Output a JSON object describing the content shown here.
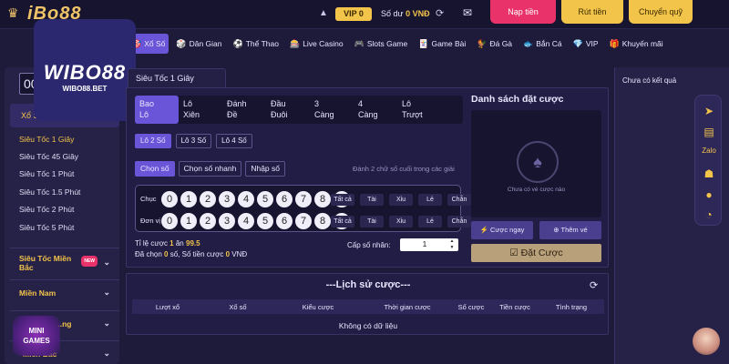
{
  "topbar": {
    "brand": "iBo88",
    "vip": "VIP 0",
    "balance_label": "Số dư",
    "balance_value": "0 VNĐ",
    "deposit": "Nạp tiền",
    "withdraw": "Rút tiền",
    "transfer": "Chuyển quỹ"
  },
  "logo": {
    "text": "WIBO88",
    "sub": "WIBO88.BET"
  },
  "nav": [
    {
      "label": "Xổ Số",
      "icon": "🎯"
    },
    {
      "label": "Dân Gian",
      "icon": "🎲"
    },
    {
      "label": "Thể Thao",
      "icon": "⚽"
    },
    {
      "label": "Live Casino",
      "icon": "🎰"
    },
    {
      "label": "Slots Game",
      "icon": "🎮"
    },
    {
      "label": "Game Bài",
      "icon": "🃏"
    },
    {
      "label": "Đá Gà",
      "icon": "🐓"
    },
    {
      "label": "Bắn Cá",
      "icon": "🐟"
    },
    {
      "label": "VIP",
      "icon": "💎"
    },
    {
      "label": "Khuyến mãi",
      "icon": "🎁"
    }
  ],
  "sidebar": {
    "timer": "00",
    "head": "Xổ Số",
    "items": [
      "Siêu Tốc 1 Giây",
      "Siêu Tốc 45 Giây",
      "Siêu Tốc 1 Phút",
      "Siêu Tốc 1.5 Phút",
      "Siêu Tốc 2 Phút",
      "Siêu Tốc 5 Phút"
    ],
    "group1_line1": "Siêu Tốc Miền",
    "group1_line2": "Bắc",
    "group1_badge": "NEW",
    "group2": "Miền Nam",
    "group3": "...ng",
    "group4": "Miền Bắc",
    "mini_line1": "MINI",
    "mini_line2": "GAMES"
  },
  "main": {
    "tab": "Siêu Tốc 1 Giây",
    "kinds": [
      {
        "l1": "Bao",
        "l2": "Lô"
      },
      {
        "l1": "Lô",
        "l2": "Xiên"
      },
      {
        "l1": "Đánh",
        "l2": "Đề"
      },
      {
        "l1": "Đầu",
        "l2": "Đuôi"
      },
      {
        "l1": "3",
        "l2": "Càng"
      },
      {
        "l1": "4",
        "l2": "Càng"
      },
      {
        "l1": "Lô",
        "l2": "Trượt"
      }
    ],
    "subtabs": [
      "Lô 2 Số",
      "Lô 3 Số",
      "Lô 4 Số"
    ],
    "modes": [
      "Chọn số",
      "Chọn số nhanh",
      "Nhập số"
    ],
    "hint": "Đánh 2 chữ số cuối trong các giải",
    "row1_label": "Chục",
    "row2_label": "Đơn vị",
    "digits": [
      "0",
      "1",
      "2",
      "3",
      "4",
      "5",
      "6",
      "7",
      "8",
      "9"
    ],
    "quick": [
      "Tất cả",
      "Tài",
      "Xỉu",
      "Lẻ",
      "Chẵn"
    ],
    "odds_prefix": "Tỉ lệ cược",
    "odds_a": "1",
    "odds_mid": "ăn",
    "odds_b": "99.5",
    "chosen_prefix": "Đã chọn",
    "chosen_count": "0",
    "chosen_mid": "số, Số tiền cược",
    "chosen_amount": "0",
    "chosen_unit": "VNĐ",
    "mult_label": "Cấp số nhân:",
    "mult_value": "1"
  },
  "betlist": {
    "title": "Danh sách đặt cược",
    "empty": "Chưa có vé cược nào",
    "fast": "⚡ Cược ngay",
    "add": "⊕ Thêm vé",
    "bet": "☑ Đặt Cược"
  },
  "history": {
    "title": "---Lịch sử cược---",
    "columns": [
      "Lượt xổ",
      "Xổ số",
      "Kiểu cược",
      "Thời gian cược",
      "Số cược",
      "Tiền cược",
      "Tình trạng"
    ],
    "empty": "Không có dữ liệu"
  },
  "right": {
    "text": "Chưa có kết quả"
  },
  "float_icons": [
    "telegram-icon",
    "chat-icon",
    "zalo-icon",
    "android-icon",
    "apple-icon",
    "speed-icon"
  ],
  "colors": {
    "accent": "#6a55d8",
    "gold": "#f3c44a",
    "pink": "#e9326a",
    "bg": "#1e1a3a"
  }
}
